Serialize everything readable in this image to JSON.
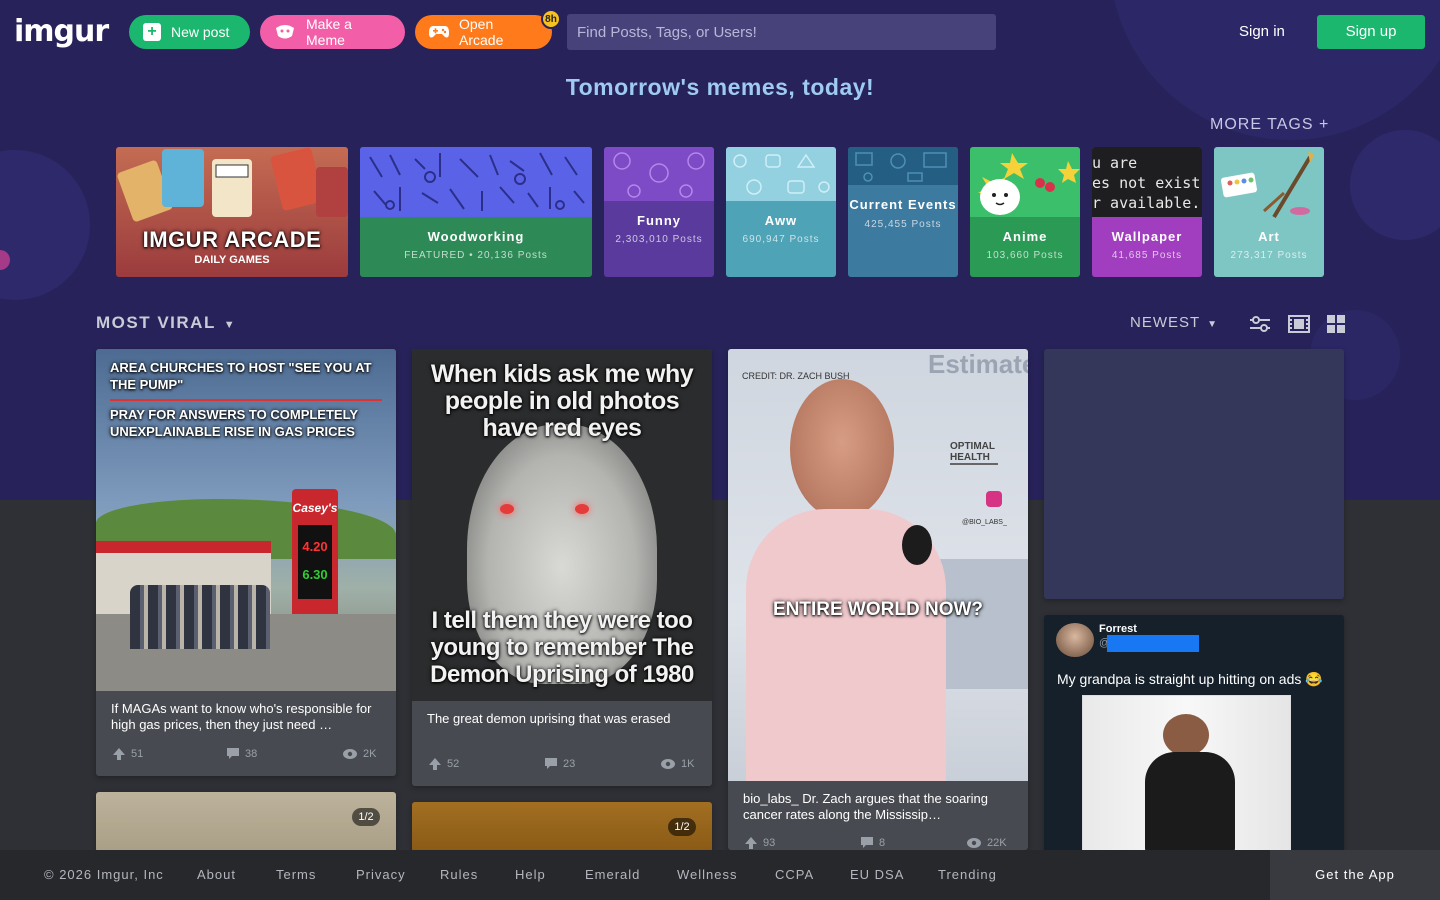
{
  "header": {
    "logo": "imgur",
    "new_post_label": "New post",
    "make_meme_label": "Make a Meme",
    "open_arcade_label": "Open Arcade",
    "arcade_badge": "8h",
    "search_placeholder": "Find Posts, Tags, or Users!",
    "sign_in_label": "Sign in",
    "sign_up_label": "Sign up"
  },
  "tagline": "Tomorrow's memes, today!",
  "more_tags_label": "MORE TAGS +",
  "arcade_tile": {
    "title": "IMGUR ARCADE",
    "subtitle": "DAILY GAMES"
  },
  "tags": [
    {
      "name": "Woodworking",
      "count": "FEATURED • 20,136 Posts"
    },
    {
      "name": "Funny",
      "count": "2,303,010 Posts"
    },
    {
      "name": "Aww",
      "count": "690,947 Posts"
    },
    {
      "name": "Current Events",
      "count": "425,455 Posts"
    },
    {
      "name": "Anime",
      "count": "103,660 Posts"
    },
    {
      "name": "Wallpaper",
      "count": "41,685 Posts"
    },
    {
      "name": "Art",
      "count": "273,317 Posts"
    }
  ],
  "wallpaper_preview_text": [
    "u are",
    "es not exist",
    "r available."
  ],
  "feed": {
    "section_label": "MOST VIRAL",
    "sort_label": "NEWEST",
    "posts": [
      {
        "image_text_1": "AREA CHURCHES TO HOST \"SEE YOU AT THE PUMP\"",
        "image_text_2": "PRAY FOR ANSWERS TO COMPLETELY UNEXPLAINABLE RISE IN GAS PRICES",
        "sign_brand": "Casey's",
        "price_1": "4.20",
        "price_2": "6.30",
        "caption": "If MAGAs want to know who's responsible for high gas prices, then they just need …",
        "upvotes": "51",
        "comments": "38",
        "views": "2K"
      },
      {
        "image_text_top": "When kids ask me why people in old photos have red eyes",
        "image_text_bottom": "I tell them they were too young to remember The Demon Uprising of 1980",
        "caption": "The great demon uprising that was erased",
        "upvotes": "52",
        "comments": "23",
        "views": "1K"
      },
      {
        "image_credit": "CREDIT: DR. ZACH BUSH",
        "image_corner": "Estimate",
        "image_badge": "OPTIMAL HEALTH",
        "image_handle": "@BIO_LABS_",
        "image_text": "ENTIRE WORLD NOW?",
        "caption": "bio_labs_ Dr. Zach argues that the soaring cancer rates along the Mississip…",
        "upvotes": "93",
        "comments": "8",
        "views": "22K"
      },
      {
        "user_name": "Forrest",
        "handle_prefix": "@",
        "tweet_text": "My grandpa is straight up hitting on ads 😂"
      }
    ],
    "album_counter_1": "1/2",
    "album_counter_2": "1/2"
  },
  "footer": {
    "links": [
      "© 2026 Imgur, Inc",
      "About",
      "Terms",
      "Privacy",
      "Rules",
      "Help",
      "Emerald",
      "Wellness",
      "CCPA",
      "EU DSA",
      "Trending"
    ],
    "get_app": "Get the App"
  },
  "colors": {
    "hero_bg": "#27235a",
    "page_bg": "#2e3035",
    "green": "#1bb76e",
    "pink": "#f25fa8",
    "orange": "#ff7a1a",
    "tagline": "#9fcbf0"
  }
}
